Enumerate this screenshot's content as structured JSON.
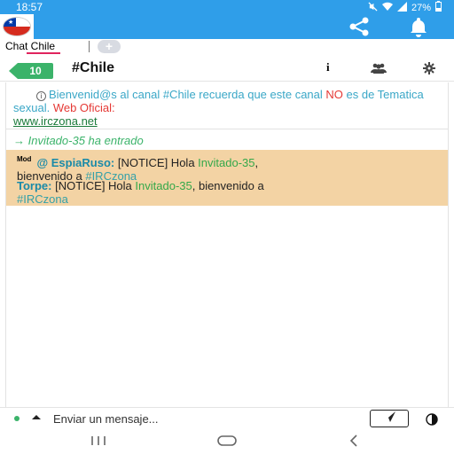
{
  "status_bar": {
    "time": "18:57",
    "battery": "27%",
    "icons": [
      "mute-icon",
      "wifi-icon",
      "signal-icon",
      "battery-icon"
    ]
  },
  "app_bar": {
    "flag_icon": "chile-flag-icon",
    "share_icon": "share-icon",
    "bell_icon": "bell-icon"
  },
  "tabs": [
    {
      "label": "Chat Chile"
    }
  ],
  "tab_add_label": "+",
  "channel": {
    "user_count": "10",
    "name": "#Chile",
    "info_label": "i"
  },
  "messages": {
    "welcome_1": "Bienvenid@s al canal #Chile recuerda que este canal ",
    "welcome_no": "NO",
    "welcome_2": " es de Tematica sexual. ",
    "welcome_web": "Web Oficial:",
    "welcome_link": "www.irczona.net",
    "join": "→ Invitado-35 ha entrado",
    "notice1_tag": "Mod",
    "notice1_nick": "@ EspiaRuso:",
    "notice1_pre": " [NOTICE] Hola ",
    "notice1_hl": "Invitado-35",
    "notice1_mid": ",",
    "notice1_line2": "bienvenido a ",
    "notice1_chan": "#IRCzona",
    "notice2_nick": "Torpe:",
    "notice2_pre": " [NOTICE] Hola ",
    "notice2_hl": "Invitado-35",
    "notice2_mid": ", bienvenido a",
    "notice2_chan": "#IRCzona"
  },
  "input": {
    "placeholder": "Enviar un mensaje..."
  },
  "colors": {
    "accent": "#2f9ee9",
    "badge": "#3bb36a",
    "notice_bg": "#f3d3a4",
    "tab_underline": "#e0245e"
  }
}
